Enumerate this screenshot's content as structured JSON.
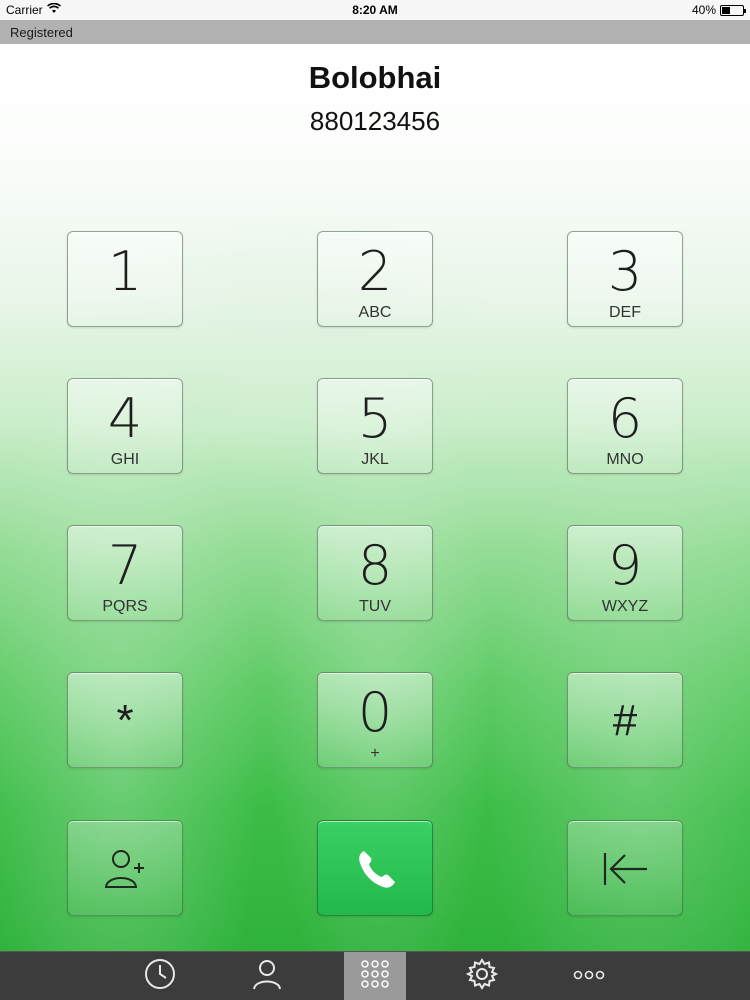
{
  "status_bar": {
    "carrier": "Carrier",
    "time": "8:20 AM",
    "battery_text": "40%",
    "battery_level": 0.4,
    "wifi_icon": "wifi-icon"
  },
  "registration": {
    "status": "Registered"
  },
  "contact": {
    "name": "Bolobhai",
    "number": "880123456"
  },
  "keypad": {
    "keys": [
      {
        "digit": "1",
        "letters": ""
      },
      {
        "digit": "2",
        "letters": "ABC"
      },
      {
        "digit": "3",
        "letters": "DEF"
      },
      {
        "digit": "4",
        "letters": "GHI"
      },
      {
        "digit": "5",
        "letters": "JKL"
      },
      {
        "digit": "6",
        "letters": "MNO"
      },
      {
        "digit": "7",
        "letters": "PQRS"
      },
      {
        "digit": "8",
        "letters": "TUV"
      },
      {
        "digit": "9",
        "letters": "WXYZ"
      },
      {
        "digit": "*",
        "letters": ""
      },
      {
        "digit": "0",
        "letters": "+"
      },
      {
        "digit": "#",
        "letters": ""
      }
    ],
    "actions": {
      "add_contact_icon": "add-contact-icon",
      "call_icon": "phone-icon",
      "backspace_icon": "backspace-icon",
      "call_color": "#22b84c"
    }
  },
  "tab_bar": {
    "tabs": [
      {
        "name": "recents",
        "icon": "clock-icon"
      },
      {
        "name": "contacts",
        "icon": "person-icon"
      },
      {
        "name": "keypad",
        "icon": "keypad-icon",
        "active": true
      },
      {
        "name": "settings",
        "icon": "gear-icon"
      },
      {
        "name": "more",
        "icon": "more-icon"
      }
    ]
  }
}
